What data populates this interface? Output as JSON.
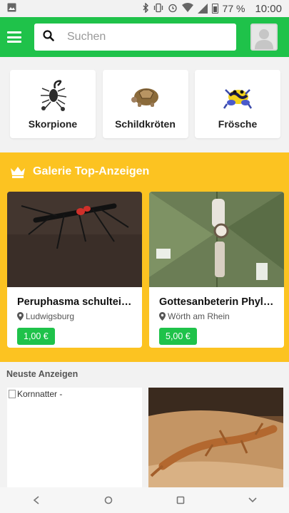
{
  "status_bar": {
    "battery": "77 %",
    "time": "10:00"
  },
  "app_bar": {
    "search_placeholder": "Suchen"
  },
  "categories": [
    {
      "label": "Skorpione",
      "icon": "scorpion-icon"
    },
    {
      "label": "Schildkröten",
      "icon": "tortoise-icon"
    },
    {
      "label": "Frösche",
      "icon": "frog-icon"
    }
  ],
  "gallery": {
    "title": "Galerie Top-Anzeigen",
    "items": [
      {
        "title": "Peruphasma schultei ...",
        "location": "Ludwigsburg",
        "price": "1,00 €"
      },
      {
        "title": "Gottesanbeterin Phyll...",
        "location": "Wörth am Rhein",
        "price": "5,00 €"
      }
    ]
  },
  "newest": {
    "title": "Neuste Anzeigen",
    "items": [
      {
        "alt_text": "Kornnatter -"
      },
      {
        "alt_text": ""
      }
    ]
  },
  "colors": {
    "primary_green": "#1fc24a",
    "gallery_yellow": "#fcc321"
  }
}
